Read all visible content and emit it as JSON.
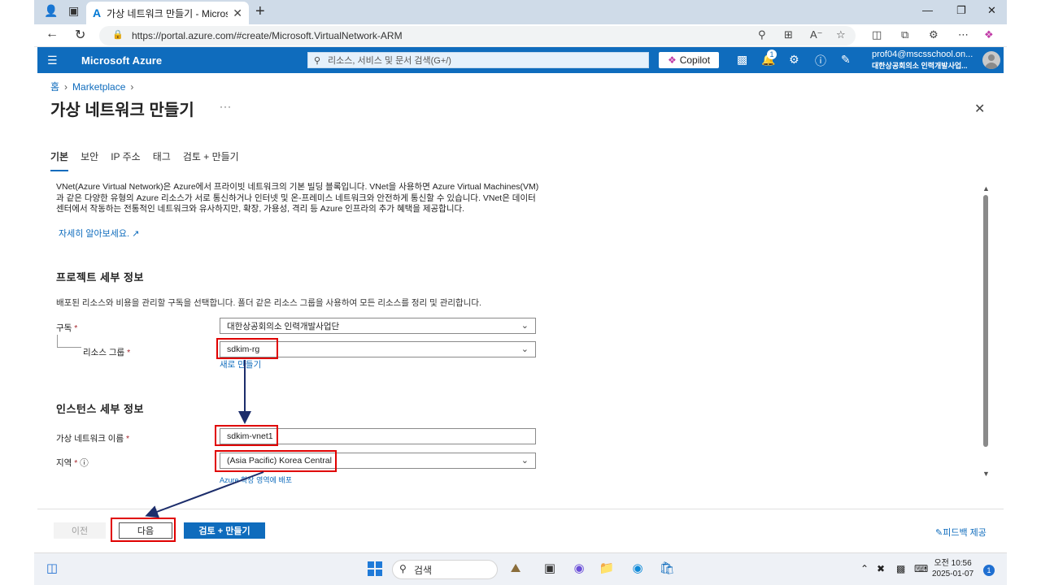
{
  "browser": {
    "tab_title": "가상 네트워크 만들기 - Microsoft",
    "tab_favicon": "azure-logo-icon",
    "url": "https://portal.azure.com/#create/Microsoft.VirtualNetwork-ARM",
    "new_tab": "+"
  },
  "portal": {
    "brand": "Microsoft Azure",
    "search_placeholder": "리소스, 서비스 및 문서 검색(G+/)",
    "copilot_label": "Copilot",
    "notification_count": "1",
    "user_email": "prof04@mscsschool.on...",
    "user_org": "대한상공회의소 인력개발사업..."
  },
  "breadcrumb": {
    "home": "홈",
    "marketplace": "Marketplace"
  },
  "page": {
    "title": "가상 네트워크 만들기",
    "more": "···"
  },
  "tabs": [
    {
      "label": "기본",
      "active": true
    },
    {
      "label": "보안"
    },
    {
      "label": "IP 주소"
    },
    {
      "label": "태그"
    },
    {
      "label": "검토 + 만들기"
    }
  ],
  "intro": {
    "description": "VNet(Azure Virtual Network)은 Azure에서 프라이빗 네트워크의 기본 빌딩 블록입니다. VNet을 사용하면 Azure Virtual Machines(VM)과 같은 다양한 유형의 Azure 리소스가 서로 통신하거나 인터넷 및 온-프레미스 네트워크와 안전하게 통신할 수 있습니다. VNet은 데이터 센터에서 작동하는 전통적인 네트워크와 유사하지만, 확장, 가용성, 격리 등 Azure 인프라의 추가 혜택을 제공합니다.",
    "learn_more": "자세히 알아보세요. ↗"
  },
  "project": {
    "heading": "프로젝트 세부 정보",
    "subtext": "배포된 리소스와 비용을 관리할 구독을 선택합니다. 폴더 같은 리소스 그룹을 사용하여 모든 리소스를 정리 및 관리합니다.",
    "subscription_label": "구독",
    "subscription_value": "대한상공회의소 인력개발사업단",
    "rg_label": "리소스 그룹",
    "rg_value": "sdkim-rg",
    "rg_create_new": "새로 만들기",
    "required_mark": "*"
  },
  "instance": {
    "heading": "인스턴스 세부 정보",
    "vnet_name_label": "가상 네트워크 이름",
    "vnet_name_value": "sdkim-vnet1",
    "region_label": "지역",
    "region_value": "(Asia Pacific) Korea Central",
    "region_info_icon": "info-icon",
    "edge_zone_link": "Azure 확장 영역에 배포"
  },
  "footer": {
    "prev_label": "이전",
    "next_label": "다음",
    "create_label": "검토 + 만들기",
    "feedback_label": "피드백 제공"
  },
  "taskbar": {
    "search_label": "검색",
    "time": "오전 10:56",
    "date": "2025-01-07",
    "notification_count": "1"
  },
  "colors": {
    "azure_blue": "#0f6cbd",
    "highlight_red": "#e00000",
    "arrow_navy": "#1c2d6b"
  }
}
